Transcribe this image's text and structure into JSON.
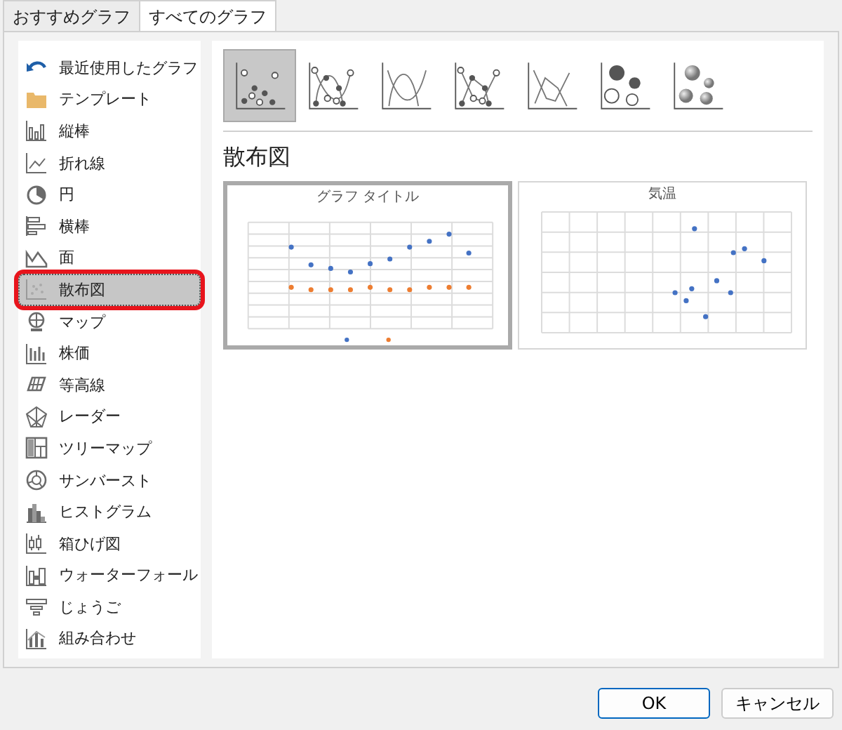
{
  "tabs": [
    {
      "label": "おすすめグラフ",
      "selected": false
    },
    {
      "label": "すべてのグラフ",
      "selected": true
    }
  ],
  "sidebar": {
    "items": [
      {
        "kind": "recent",
        "label": "最近使用したグラフ",
        "selected": false,
        "callout": false
      },
      {
        "kind": "template",
        "label": "テンプレート",
        "selected": false,
        "callout": false
      },
      {
        "kind": "column",
        "label": "縦棒",
        "selected": false,
        "callout": false
      },
      {
        "kind": "line",
        "label": "折れ線",
        "selected": false,
        "callout": false
      },
      {
        "kind": "pie",
        "label": "円",
        "selected": false,
        "callout": false
      },
      {
        "kind": "bar",
        "label": "横棒",
        "selected": false,
        "callout": false
      },
      {
        "kind": "area",
        "label": "面",
        "selected": false,
        "callout": false
      },
      {
        "kind": "scatter",
        "label": "散布図",
        "selected": true,
        "callout": true
      },
      {
        "kind": "map",
        "label": "マップ",
        "selected": false,
        "callout": false
      },
      {
        "kind": "stock",
        "label": "株価",
        "selected": false,
        "callout": false
      },
      {
        "kind": "surface",
        "label": "等高線",
        "selected": false,
        "callout": false
      },
      {
        "kind": "radar",
        "label": "レーダー",
        "selected": false,
        "callout": false
      },
      {
        "kind": "treemap",
        "label": "ツリーマップ",
        "selected": false,
        "callout": false
      },
      {
        "kind": "sunburst",
        "label": "サンバースト",
        "selected": false,
        "callout": false
      },
      {
        "kind": "histogram",
        "label": "ヒストグラム",
        "selected": false,
        "callout": false
      },
      {
        "kind": "boxplot",
        "label": "箱ひげ図",
        "selected": false,
        "callout": false
      },
      {
        "kind": "waterfall",
        "label": "ウォーターフォール",
        "selected": false,
        "callout": false
      },
      {
        "kind": "funnel",
        "label": "じょうご",
        "selected": false,
        "callout": false
      },
      {
        "kind": "combo",
        "label": "組み合わせ",
        "selected": false,
        "callout": false
      }
    ]
  },
  "subtypes": [
    {
      "kind": "markers",
      "selected": true
    },
    {
      "kind": "smooth_markers",
      "selected": false
    },
    {
      "kind": "smooth",
      "selected": false
    },
    {
      "kind": "straight_markers",
      "selected": false
    },
    {
      "kind": "straight",
      "selected": false
    },
    {
      "kind": "bubble",
      "selected": false
    },
    {
      "kind": "bubble_3d",
      "selected": false
    }
  ],
  "heading": "散布図",
  "previews": [
    {
      "kind": "time_series",
      "title": "グラフ タイトル",
      "selected": true
    },
    {
      "kind": "xy",
      "title": "気温",
      "selected": false
    }
  ],
  "buttons": [
    {
      "label": "OK",
      "default": true
    },
    {
      "label": "キャンセル",
      "default": false
    }
  ]
}
